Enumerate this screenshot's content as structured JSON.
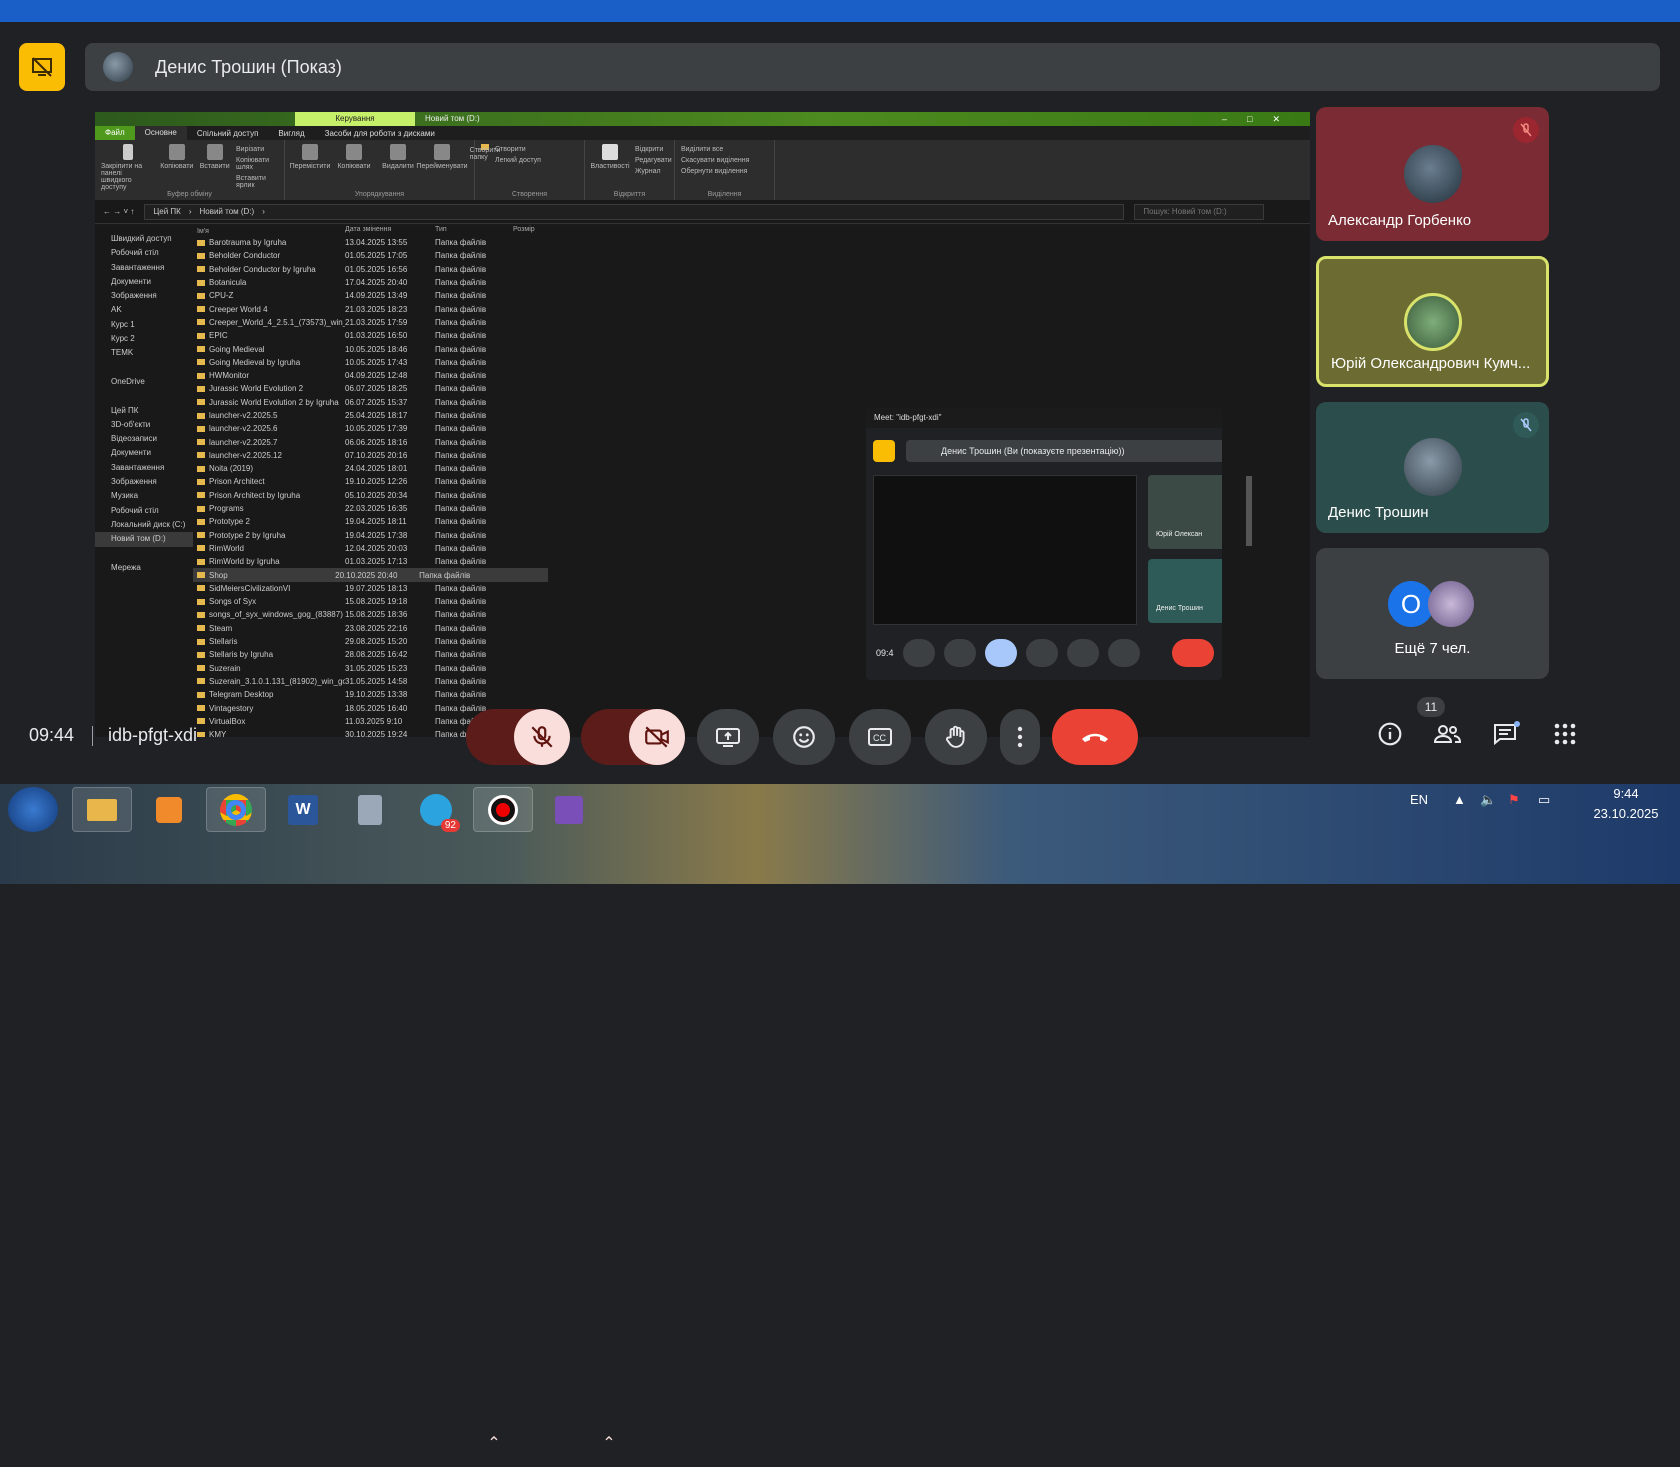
{
  "presenter": {
    "name": "Денис Трошин (Показ)"
  },
  "explorer": {
    "context_tab": "Керування",
    "window_title": "Новий том (D:)",
    "ribbon_tabs": [
      "Файл",
      "Основне",
      "Спільний доступ",
      "Вигляд",
      "Засоби для роботи з дисками"
    ],
    "ribbon_groups": [
      {
        "caption": "Буфер обміну",
        "buttons": [
          "Закріпити на панелі швидкого доступу",
          "Копіювати",
          "Вставити"
        ],
        "small": [
          "Вирізати",
          "Копіювати шлях",
          "Вставити ярлик"
        ]
      },
      {
        "caption": "Упорядкування",
        "buttons": [
          "Перемістити",
          "Копіювати",
          "Видалити",
          "Перейменувати"
        ],
        "small": []
      },
      {
        "caption": "Створення",
        "buttons": [
          "Створити папку"
        ],
        "small": [
          "Створити",
          "Легкий доступ"
        ]
      },
      {
        "caption": "Відкриття",
        "buttons": [
          "Властивості"
        ],
        "small": [
          "Відкрити",
          "Редагувати",
          "Журнал"
        ]
      },
      {
        "caption": "Виділення",
        "buttons": [],
        "small": [
          "Виділити все",
          "Скасувати виділення",
          "Обернути виділення"
        ]
      }
    ],
    "breadcrumb": [
      "Цей ПК",
      "Новий том (D:)"
    ],
    "search_placeholder": "Пошук: Новий том (D:)",
    "nav_items": [
      {
        "label": "Швидкий доступ",
        "selected": false
      },
      {
        "label": "Робочий стіл",
        "selected": false
      },
      {
        "label": "Завантаження",
        "selected": false
      },
      {
        "label": "Документи",
        "selected": false
      },
      {
        "label": "Зображення",
        "selected": false
      },
      {
        "label": "AK",
        "selected": false
      },
      {
        "label": "Курс 1",
        "selected": false
      },
      {
        "label": "Курс 2",
        "selected": false
      },
      {
        "label": "TEMK",
        "selected": false
      },
      {
        "label": "",
        "selected": false
      },
      {
        "label": "OneDrive",
        "selected": false
      },
      {
        "label": "",
        "selected": false
      },
      {
        "label": "Цей ПК",
        "selected": false
      },
      {
        "label": "3D-об'єкти",
        "selected": false
      },
      {
        "label": "Відеозаписи",
        "selected": false
      },
      {
        "label": "Документи",
        "selected": false
      },
      {
        "label": "Завантаження",
        "selected": false
      },
      {
        "label": "Зображення",
        "selected": false
      },
      {
        "label": "Музика",
        "selected": false
      },
      {
        "label": "Робочий стіл",
        "selected": false
      },
      {
        "label": "Локальний диск (C:)",
        "selected": false
      },
      {
        "label": "Новий том (D:)",
        "selected": true
      },
      {
        "label": "",
        "selected": false
      },
      {
        "label": "Мережа",
        "selected": false
      }
    ],
    "columns": [
      "Ім'я",
      "Дата змінення",
      "Тип",
      "Розмір"
    ],
    "files": [
      {
        "name": "Barotrauma by Igruha",
        "date": "13.04.2025 13:55",
        "type": "Папка файлів"
      },
      {
        "name": "Beholder Conductor",
        "date": "01.05.2025 17:05",
        "type": "Папка файлів"
      },
      {
        "name": "Beholder Conductor by Igruha",
        "date": "01.05.2025 16:56",
        "type": "Папка файлів"
      },
      {
        "name": "Botanicula",
        "date": "17.04.2025 20:40",
        "type": "Папка файлів"
      },
      {
        "name": "CPU-Z",
        "date": "14.09.2025 13:49",
        "type": "Папка файлів"
      },
      {
        "name": "Creeper World 4",
        "date": "21.03.2025 18:23",
        "type": "Папка файлів"
      },
      {
        "name": "Creeper_World_4_2.5.1_(73573)_win_gog",
        "date": "21.03.2025 17:59",
        "type": "Папка файлів"
      },
      {
        "name": "EPIC",
        "date": "01.03.2025 16:50",
        "type": "Папка файлів"
      },
      {
        "name": "Going Medieval",
        "date": "10.05.2025 18:46",
        "type": "Папка файлів"
      },
      {
        "name": "Going Medieval by Igruha",
        "date": "10.05.2025 17:43",
        "type": "Папка файлів"
      },
      {
        "name": "HWMonitor",
        "date": "04.09.2025 12:48",
        "type": "Папка файлів"
      },
      {
        "name": "Jurassic World Evolution 2",
        "date": "06.07.2025 18:25",
        "type": "Папка файлів"
      },
      {
        "name": "Jurassic World Evolution 2 by Igruha",
        "date": "06.07.2025 15:37",
        "type": "Папка файлів"
      },
      {
        "name": "launcher-v2.2025.5",
        "date": "25.04.2025 18:17",
        "type": "Папка файлів"
      },
      {
        "name": "launcher-v2.2025.6",
        "date": "10.05.2025 17:39",
        "type": "Папка файлів"
      },
      {
        "name": "launcher-v2.2025.7",
        "date": "06.06.2025 18:16",
        "type": "Папка файлів"
      },
      {
        "name": "launcher-v2.2025.12",
        "date": "07.10.2025 20:16",
        "type": "Папка файлів"
      },
      {
        "name": "Noita (2019)",
        "date": "24.04.2025 18:01",
        "type": "Папка файлів"
      },
      {
        "name": "Prison Architect",
        "date": "19.10.2025 12:26",
        "type": "Папка файлів"
      },
      {
        "name": "Prison Architect by Igruha",
        "date": "05.10.2025 20:34",
        "type": "Папка файлів"
      },
      {
        "name": "Programs",
        "date": "22.03.2025 16:35",
        "type": "Папка файлів"
      },
      {
        "name": "Prototype 2",
        "date": "19.04.2025 18:11",
        "type": "Папка файлів"
      },
      {
        "name": "Prototype 2 by Igruha",
        "date": "19.04.2025 17:38",
        "type": "Папка файлів"
      },
      {
        "name": "RimWorld",
        "date": "12.04.2025 20:03",
        "type": "Папка файлів"
      },
      {
        "name": "RimWorld by Igruha",
        "date": "01.03.2025 17:13",
        "type": "Папка файлів"
      },
      {
        "name": "Shop",
        "date": "20.10.2025 20:40",
        "type": "Папка файлів",
        "selected": true
      },
      {
        "name": "SidMeiersCivilizationVI",
        "date": "19.07.2025 18:13",
        "type": "Папка файлів"
      },
      {
        "name": "Songs of Syx",
        "date": "15.08.2025 19:18",
        "type": "Папка файлів"
      },
      {
        "name": "songs_of_syx_windows_gog_(83887)",
        "date": "15.08.2025 18:36",
        "type": "Папка файлів"
      },
      {
        "name": "Steam",
        "date": "23.08.2025 22:16",
        "type": "Папка файлів"
      },
      {
        "name": "Stellaris",
        "date": "29.08.2025 15:20",
        "type": "Папка файлів"
      },
      {
        "name": "Stellaris by Igruha",
        "date": "28.08.2025 16:42",
        "type": "Папка файлів"
      },
      {
        "name": "Suzerain",
        "date": "31.05.2025 15:23",
        "type": "Папка файлів"
      },
      {
        "name": "Suzerain_3.1.0.1.131_(81902)_win_gog",
        "date": "31.05.2025 14:58",
        "type": "Папка файлів"
      },
      {
        "name": "Telegram Desktop",
        "date": "19.10.2025 13:38",
        "type": "Папка файлів"
      },
      {
        "name": "Vintagestory",
        "date": "18.05.2025 16:40",
        "type": "Папка файлів"
      },
      {
        "name": "VirtualBox",
        "date": "11.03.2025 9:10",
        "type": "Папка файлів"
      },
      {
        "name": "KMY",
        "date": "30.10.2025 19:24",
        "type": "Папка файлів"
      }
    ]
  },
  "pip": {
    "title": "Meet: \"idb-pfgt-xdi\"",
    "presenting_text": "Денис Трошин (Ви (показуєте презентацію))",
    "tile1_name": "Юрій Олексан",
    "tile2_name": "Денис Трошин",
    "time": "09:4"
  },
  "participants": [
    {
      "name": "Александр Горбенко",
      "muted": true
    },
    {
      "name": "Юрій Олександрович Кумч...",
      "muted": false,
      "speaking": true
    },
    {
      "name": "Денис Трошин",
      "muted": true
    },
    {
      "name": "Ещё 7 чел.",
      "initial": "О"
    }
  ],
  "meeting": {
    "time": "09:44",
    "code": "idb-pfgt-xdi",
    "participant_count": "11"
  },
  "taskbar": {
    "telegram_badge": "92",
    "lang": "EN",
    "clock_time": "9:44",
    "clock_date": "23.10.2025"
  }
}
